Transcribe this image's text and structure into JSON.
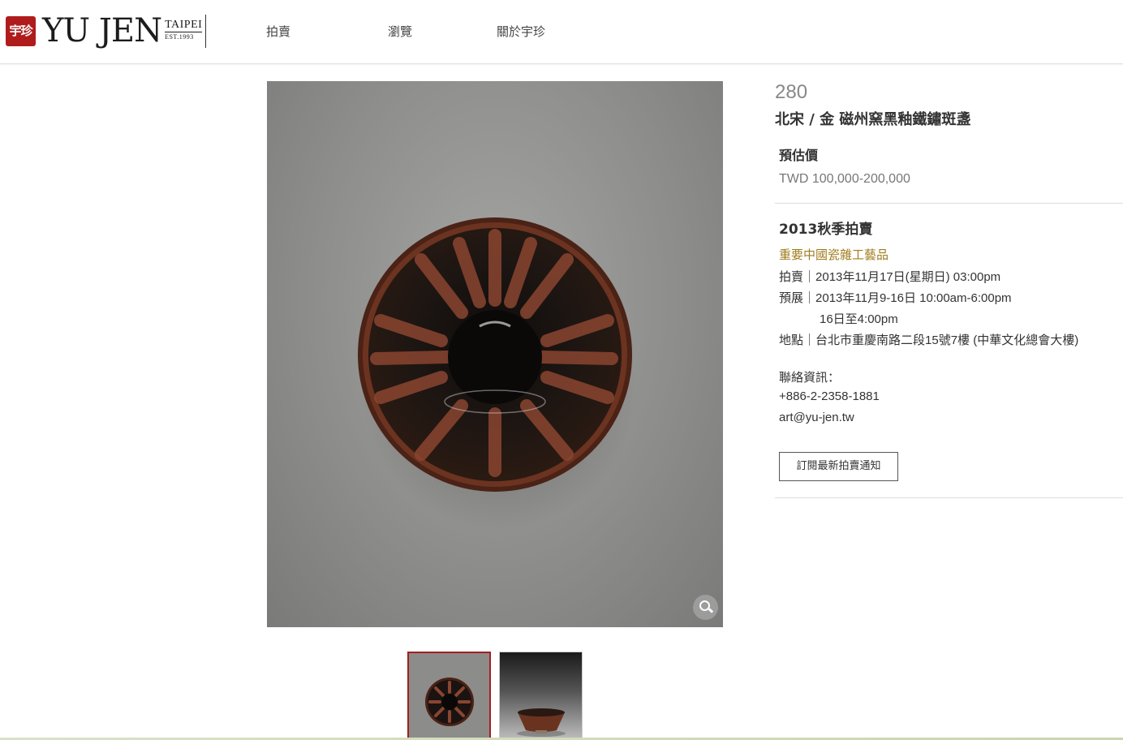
{
  "header": {
    "logo": {
      "seal_text": "宇珍",
      "wordmark": "YU JEN",
      "city": "TAIPEI",
      "established": "EST.1993"
    },
    "nav": [
      {
        "label": "拍賣"
      },
      {
        "label": "瀏覽"
      },
      {
        "label": "關於宇珍"
      }
    ]
  },
  "lot": {
    "number": "280",
    "title": "北宋 / 金 磁州窯黑釉鐵鏽斑盞",
    "estimate_label": "預估價",
    "estimate_value": "TWD  100,000-200,000"
  },
  "sale": {
    "title": "2013秋季拍賣",
    "category": "重要中國瓷雜工藝品",
    "auction_label": "拍賣｜",
    "auction_value": "2013年11月17日(星期日) 03:00pm",
    "preview_label": "預展｜",
    "preview_value": "2013年11月9-16日 10:00am-6:00pm",
    "preview_value_2": "16日至4:00pm",
    "venue_label": "地點｜",
    "venue_value": "台北市重慶南路二段15號7樓 (中華文化總會大樓)"
  },
  "contact": {
    "label": "聯絡資訊：",
    "phone": "+886-2-2358-1881",
    "email": "art@yu-jen.tw"
  },
  "subscribe_label": "訂閱最新拍賣通知",
  "colors": {
    "seal_red": "#b01c1c",
    "category_gold": "#a07c1e",
    "thumb_active_border": "#a31f1f"
  },
  "icons": {
    "zoom": "magnifier-icon"
  }
}
